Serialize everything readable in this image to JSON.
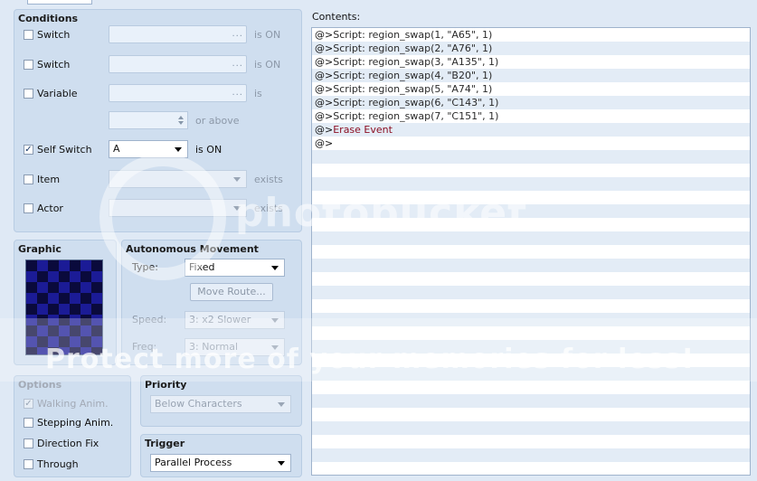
{
  "conditions": {
    "title": "Conditions",
    "switch1": {
      "label": "Switch",
      "checked": false,
      "suffix": "is ON"
    },
    "switch2": {
      "label": "Switch",
      "checked": false,
      "suffix": "is ON"
    },
    "variable": {
      "label": "Variable",
      "checked": false,
      "suffix": "is",
      "or_above": "or above"
    },
    "self_switch": {
      "label": "Self Switch",
      "checked": true,
      "value": "A",
      "suffix": "is ON"
    },
    "item": {
      "label": "Item",
      "checked": false,
      "suffix": "exists"
    },
    "actor": {
      "label": "Actor",
      "checked": false,
      "suffix": "exists"
    }
  },
  "graphic": {
    "title": "Graphic"
  },
  "autonomous": {
    "title": "Autonomous Movement",
    "type_label": "Type:",
    "type_value": "Fixed",
    "move_route_button": "Move Route...",
    "speed_label": "Speed:",
    "speed_value": "3: x2 Slower",
    "freq_label": "Freq:",
    "freq_value": "3: Normal"
  },
  "options": {
    "title": "Options",
    "walking": {
      "label": "Walking Anim.",
      "checked": true
    },
    "stepping": {
      "label": "Stepping Anim.",
      "checked": false
    },
    "direction_fix": {
      "label": "Direction Fix",
      "checked": false
    },
    "through": {
      "label": "Through",
      "checked": false
    }
  },
  "priority": {
    "title": "Priority",
    "value": "Below Characters"
  },
  "trigger": {
    "title": "Trigger",
    "value": "Parallel Process"
  },
  "contents": {
    "label": "Contents:",
    "lines": [
      {
        "prefix": "@>",
        "text": "Script: region_swap(1, \"A65\", 1)",
        "kind": "script"
      },
      {
        "prefix": "@>",
        "text": "Script: region_swap(2, \"A76\", 1)",
        "kind": "script"
      },
      {
        "prefix": "@>",
        "text": "Script: region_swap(3, \"A135\", 1)",
        "kind": "script"
      },
      {
        "prefix": "@>",
        "text": "Script: region_swap(4, \"B20\", 1)",
        "kind": "script"
      },
      {
        "prefix": "@>",
        "text": "Script: region_swap(5, \"A74\", 1)",
        "kind": "script"
      },
      {
        "prefix": "@>",
        "text": "Script: region_swap(6, \"C143\", 1)",
        "kind": "script"
      },
      {
        "prefix": "@>",
        "text": "Script: region_swap(7, \"C151\", 1)",
        "kind": "script"
      },
      {
        "prefix": "@>",
        "text": "Erase Event",
        "kind": "erase"
      },
      {
        "prefix": "@>",
        "text": "",
        "kind": "empty"
      }
    ]
  },
  "watermark": {
    "brand": "photobucket",
    "banner": "Protect more of your memories for less!"
  }
}
